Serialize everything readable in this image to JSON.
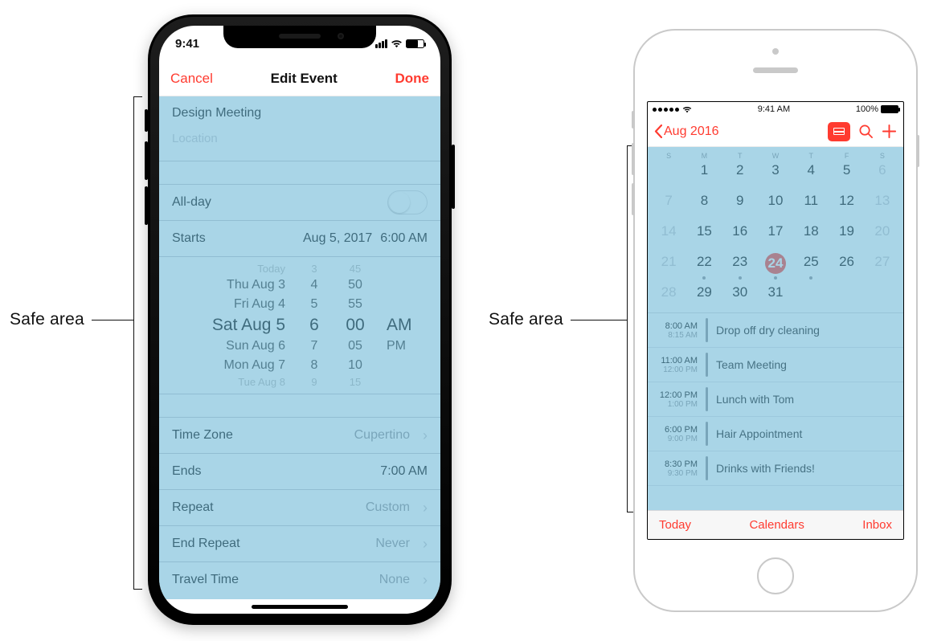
{
  "labels": {
    "safe_area": "Safe area"
  },
  "accent": "#ff3b30",
  "left": {
    "status": {
      "time": "9:41"
    },
    "nav": {
      "cancel": "Cancel",
      "title": "Edit Event",
      "done": "Done"
    },
    "event": {
      "title": "Design Meeting",
      "location_placeholder": "Location"
    },
    "rows": {
      "allday": "All-day",
      "starts": {
        "label": "Starts",
        "date": "Aug 5, 2017",
        "time": "6:00 AM"
      },
      "timezone": {
        "label": "Time Zone",
        "value": "Cupertino"
      },
      "ends": {
        "label": "Ends",
        "value": "7:00 AM"
      },
      "repeat": {
        "label": "Repeat",
        "value": "Custom"
      },
      "end_repeat": {
        "label": "End Repeat",
        "value": "Never"
      },
      "travel": {
        "label": "Travel Time",
        "value": "None"
      }
    },
    "picker": {
      "rows": [
        {
          "day": "Today",
          "h": "3",
          "m": "45",
          "ap": ""
        },
        {
          "day": "Thu Aug 3",
          "h": "4",
          "m": "50",
          "ap": ""
        },
        {
          "day": "Fri Aug 4",
          "h": "5",
          "m": "55",
          "ap": ""
        },
        {
          "day": "Sat Aug 5",
          "h": "6",
          "m": "00",
          "ap": "AM"
        },
        {
          "day": "Sun Aug 6",
          "h": "7",
          "m": "05",
          "ap": "PM"
        },
        {
          "day": "Mon Aug 7",
          "h": "8",
          "m": "10",
          "ap": ""
        },
        {
          "day": "Tue Aug 8",
          "h": "9",
          "m": "15",
          "ap": ""
        }
      ],
      "selected_index": 3
    }
  },
  "right": {
    "status": {
      "time": "9:41 AM",
      "battery": "100%"
    },
    "nav": {
      "back": "Aug 2016"
    },
    "week_header": [
      "S",
      "M",
      "T",
      "W",
      "T",
      "F",
      "S"
    ],
    "calendar": [
      [
        null,
        1,
        2,
        3,
        4,
        5,
        6
      ],
      [
        7,
        8,
        9,
        10,
        11,
        12,
        13
      ],
      [
        14,
        15,
        16,
        17,
        18,
        19,
        20
      ],
      [
        21,
        22,
        23,
        24,
        25,
        26,
        27
      ],
      [
        28,
        29,
        30,
        31,
        null,
        null,
        null
      ]
    ],
    "muted_columns": [
      0,
      6
    ],
    "selected": 24,
    "dots": [
      22,
      23,
      24,
      25
    ],
    "events": [
      {
        "start": "8:00 AM",
        "end": "8:15 AM",
        "title": "Drop off dry cleaning"
      },
      {
        "start": "11:00 AM",
        "end": "12:00 PM",
        "title": "Team Meeting"
      },
      {
        "start": "12:00 PM",
        "end": "1:00 PM",
        "title": "Lunch with Tom"
      },
      {
        "start": "6:00 PM",
        "end": "9:00 PM",
        "title": "Hair Appointment"
      },
      {
        "start": "8:30 PM",
        "end": "9:30 PM",
        "title": "Drinks with Friends!"
      }
    ],
    "toolbar": {
      "today": "Today",
      "calendars": "Calendars",
      "inbox": "Inbox"
    }
  }
}
